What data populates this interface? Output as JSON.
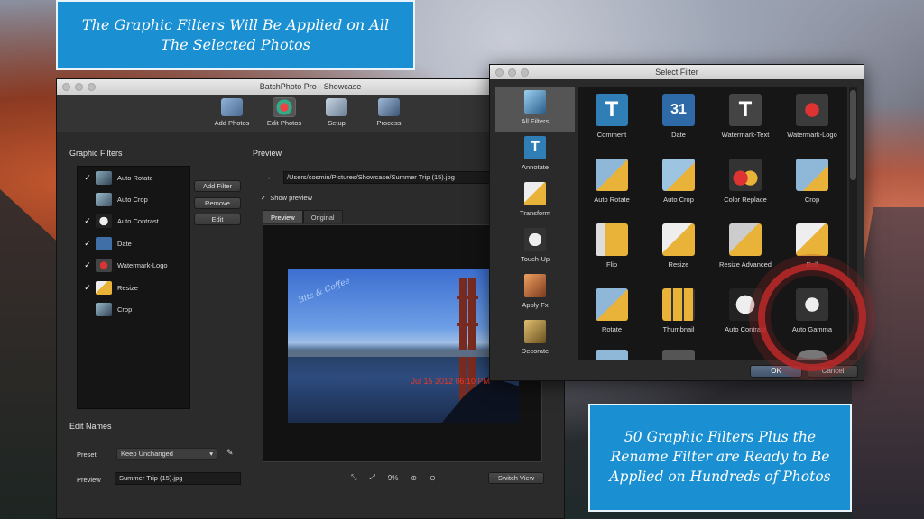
{
  "banners": {
    "top": "The Graphic Filters Will Be Applied on All The Selected Photos",
    "bottom": "50 Graphic Filters Plus the Rename Filter are Ready to Be Applied on Hundreds of Photos"
  },
  "main_window": {
    "title": "BatchPhoto Pro - Showcase",
    "toolbar": [
      {
        "label": "Add Photos",
        "icon": "add-photos-icon"
      },
      {
        "label": "Edit Photos",
        "icon": "edit-photos-icon"
      },
      {
        "label": "Setup",
        "icon": "setup-icon"
      },
      {
        "label": "Process",
        "icon": "process-icon"
      }
    ],
    "graphic_filters_title": "Graphic Filters",
    "filters": [
      {
        "label": "Auto Rotate",
        "checked": true
      },
      {
        "label": "Auto Crop",
        "checked": false
      },
      {
        "label": "Auto Contrast",
        "checked": true
      },
      {
        "label": "Date",
        "checked": true
      },
      {
        "label": "Watermark-Logo",
        "checked": true
      },
      {
        "label": "Resize",
        "checked": true
      },
      {
        "label": "Crop",
        "checked": false
      }
    ],
    "filter_buttons": {
      "add": "Add Filter",
      "remove": "Remove",
      "edit": "Edit"
    },
    "preview_title": "Preview",
    "path": "/Users/cosmin/Pictures/Showcase/Summer Trip (15).jpg",
    "show_preview_label": "Show preview",
    "tabs": {
      "preview": "Preview",
      "original": "Original"
    },
    "photo": {
      "watermark": "Bits & Coffee",
      "date_stamp": "Jul 15 2012 06:10 PM"
    },
    "zoom_level": "9%",
    "switch_view": "Switch View",
    "edit_names": {
      "title": "Edit Names",
      "preset_label": "Preset",
      "preset_value": "Keep Unchanged",
      "preview_label": "Preview",
      "preview_value": "Summer Trip (15).jpg"
    }
  },
  "dialog": {
    "title": "Select Filter",
    "categories": [
      "All Filters",
      "Annotate",
      "Transform",
      "Touch-Up",
      "Apply Fx",
      "Decorate"
    ],
    "filters": [
      [
        "Comment",
        "Date",
        "Watermark-Text",
        "Watermark-Logo"
      ],
      [
        "Auto Rotate",
        "Auto Crop",
        "Color Replace",
        "Crop"
      ],
      [
        "Flip",
        "Resize",
        "Resize Advanced",
        "Roll"
      ],
      [
        "Rotate",
        "Thumbnail",
        "Auto Contrast",
        "Auto Gamma"
      ]
    ],
    "ok": "OK",
    "cancel": "Cancel"
  },
  "colors": {
    "banner": "#1a8fd1",
    "highlight_ring": "#b92828",
    "date_stamp": "#e43a2c"
  }
}
